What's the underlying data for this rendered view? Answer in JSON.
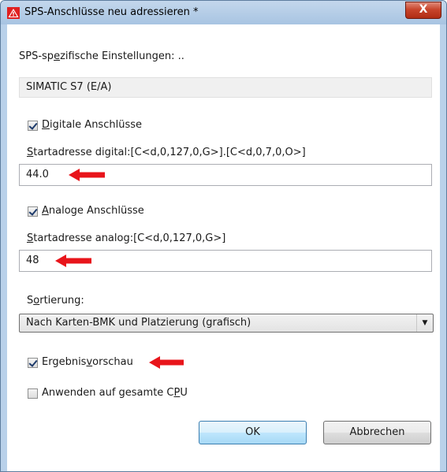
{
  "window": {
    "title": "SPS-Anschlüsse neu adressieren *",
    "close_glyph": "X"
  },
  "section": {
    "label_pre": "SPS-sp",
    "label_u": "e",
    "label_post": "zifische Einstellungen: ..",
    "value": "SIMATIC S7 (E/A)"
  },
  "digital": {
    "checkbox_u": "D",
    "checkbox_rest": "igitale Anschlüsse",
    "checked": true,
    "start_label_u": "S",
    "start_label_rest": "tartadresse digital:[C<d,0,127,0,G>].[C<d,0,7,0,O>]",
    "start_value": "44.0"
  },
  "analog": {
    "checkbox_u": "A",
    "checkbox_rest": "naloge Anschlüsse",
    "checked": true,
    "start_label_u": "S",
    "start_label_rest": "tartadresse analog:[C<d,0,127,0,G>]",
    "start_value": "48"
  },
  "sorting": {
    "label_pre": "S",
    "label_u": "o",
    "label_post": "rtierung:",
    "selected": "Nach Karten-BMK und Platzierung (grafisch)"
  },
  "preview": {
    "label_pre": "Ergebnis",
    "label_u": "v",
    "label_post": "orschau",
    "checked": true
  },
  "apply_cpu": {
    "label_pre": "Anwenden auf gesamte C",
    "label_u": "P",
    "label_post": "U",
    "checked": false
  },
  "buttons": {
    "ok": "OK",
    "cancel": "Abbrechen"
  },
  "colors": {
    "annotation_arrow": "#e8151b",
    "warning_icon": "#e02020"
  },
  "icons": {
    "title": "warning-triangle-icon",
    "combo": "dropdown-arrow-icon"
  }
}
